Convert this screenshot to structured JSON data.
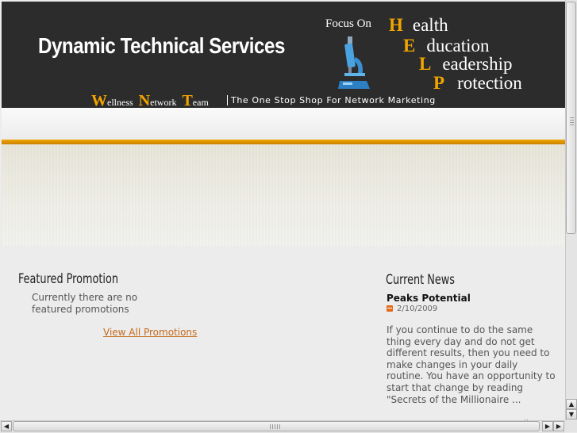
{
  "header": {
    "brand": "Dynamic Technical Services",
    "focus_on": "Focus On",
    "help": [
      {
        "cap": "H",
        "rest": "ealth"
      },
      {
        "cap": "E",
        "rest": "ducation"
      },
      {
        "cap": "L",
        "rest": "eadership"
      },
      {
        "cap": "P",
        "rest": "rotection"
      }
    ],
    "team": [
      {
        "cap": "W",
        "rest": "ellness"
      },
      {
        "cap": "N",
        "rest": "etwork"
      },
      {
        "cap": "T",
        "rest": "eam"
      }
    ],
    "tagline": "The One Stop Shop For Network Marketing",
    "accent_color": "#f2a500"
  },
  "promotion": {
    "title": "Featured Promotion",
    "text": "Currently there are no featured promotions",
    "link": "View All Promotions"
  },
  "news": {
    "title": "Current News",
    "item_title": "Peaks Potential",
    "date": "2/10/2009",
    "body": "If you continue to do the same thing every day and do not get different results, then you need to make changes in your daily routine. You have an opportunity to start that change by reading \"Secrets of the Millionaire ..."
  }
}
